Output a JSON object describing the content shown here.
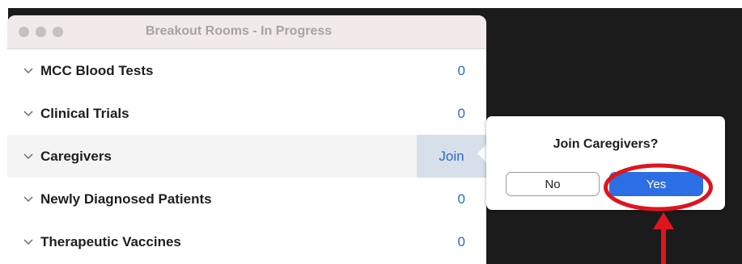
{
  "window": {
    "title": "Breakout Rooms - In Progress"
  },
  "rooms": [
    {
      "name": "MCC Blood Tests",
      "count": "0"
    },
    {
      "name": "Clinical Trials",
      "count": "0"
    },
    {
      "name": "Caregivers",
      "action": "Join"
    },
    {
      "name": "Newly Diagnosed Patients",
      "count": "0"
    },
    {
      "name": "Therapeutic Vaccines",
      "count": "0"
    }
  ],
  "popover": {
    "title": "Join Caregivers?",
    "no_label": "No",
    "yes_label": "Yes"
  },
  "colors": {
    "accent": "#2c6ee3",
    "count_blue": "#2b6ccf",
    "annotation_red": "#e0141e",
    "join_highlight": "#d6dfea"
  }
}
